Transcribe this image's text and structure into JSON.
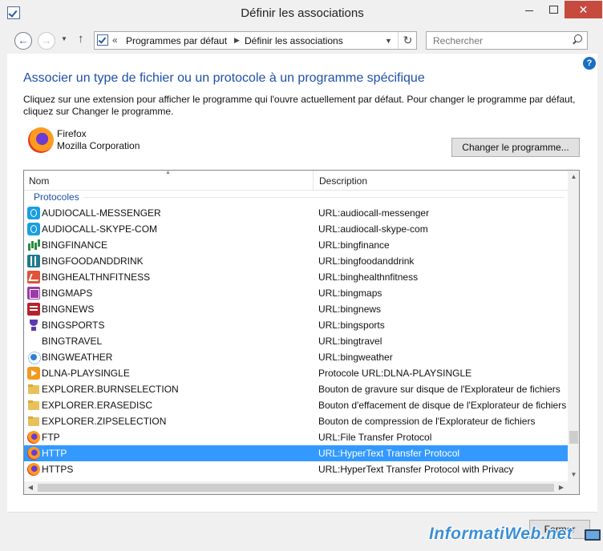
{
  "window": {
    "title": "Définir les associations"
  },
  "address": {
    "chevron": "«",
    "crumbs": [
      "Programmes par défaut",
      "Définir les associations"
    ]
  },
  "search": {
    "placeholder": "Rechercher"
  },
  "main": {
    "heading": "Associer un type de fichier ou un protocole à un programme spécifique",
    "description": "Cliquez sur une extension pour afficher le programme qui l'ouvre actuellement par défaut. Pour changer le programme par défaut, cliquez sur Changer le programme.",
    "program": {
      "name": "Firefox",
      "company": "Mozilla Corporation"
    },
    "change_button": "Changer le programme..."
  },
  "list": {
    "columns": {
      "name": "Nom",
      "description": "Description"
    },
    "group": "Protocoles",
    "rows": [
      {
        "name": "AUDIOCALL-MESSENGER",
        "description": "URL:audiocall-messenger",
        "icon": "skype-icon"
      },
      {
        "name": "AUDIOCALL-SKYPE-COM",
        "description": "URL:audiocall-skype-com",
        "icon": "skype-icon"
      },
      {
        "name": "BINGFINANCE",
        "description": "URL:bingfinance",
        "icon": "finance-icon"
      },
      {
        "name": "BINGFOODANDDRINK",
        "description": "URL:bingfoodanddrink",
        "icon": "food-icon"
      },
      {
        "name": "BINGHEALTHNFITNESS",
        "description": "URL:binghealthnfitness",
        "icon": "health-icon"
      },
      {
        "name": "BINGMAPS",
        "description": "URL:bingmaps",
        "icon": "maps-icon"
      },
      {
        "name": "BINGNEWS",
        "description": "URL:bingnews",
        "icon": "news-icon"
      },
      {
        "name": "BINGSPORTS",
        "description": "URL:bingsports",
        "icon": "trophy-icon"
      },
      {
        "name": "BINGTRAVEL",
        "description": "URL:bingtravel",
        "icon": ""
      },
      {
        "name": "BINGWEATHER",
        "description": "URL:bingweather",
        "icon": "sun-icon"
      },
      {
        "name": "DLNA-PLAYSINGLE",
        "description": "Protocole URL:DLNA-PLAYSINGLE",
        "icon": "media-play-icon"
      },
      {
        "name": "EXPLORER.BURNSELECTION",
        "description": "Bouton de gravure sur disque de l'Explorateur de fichiers",
        "icon": "folder-icon"
      },
      {
        "name": "EXPLORER.ERASEDISC",
        "description": "Bouton d'effacement de disque de l'Explorateur de fichiers",
        "icon": "folder-icon"
      },
      {
        "name": "EXPLORER.ZIPSELECTION",
        "description": "Bouton de compression de l'Explorateur de fichiers",
        "icon": "folder-icon"
      },
      {
        "name": "FTP",
        "description": "URL:File Transfer Protocol",
        "icon": "firefox-icon"
      },
      {
        "name": "HTTP",
        "description": "URL:HyperText Transfer Protocol",
        "icon": "firefox-icon",
        "selected": true
      },
      {
        "name": "HTTPS",
        "description": "URL:HyperText Transfer Protocol with Privacy",
        "icon": "firefox-icon"
      }
    ]
  },
  "footer": {
    "close_button": "Fermer"
  },
  "watermark": "InformatiWeb.net",
  "colors": {
    "accent_heading": "#1e4fa8",
    "selection": "#3399ff",
    "close": "#c74a3e"
  }
}
